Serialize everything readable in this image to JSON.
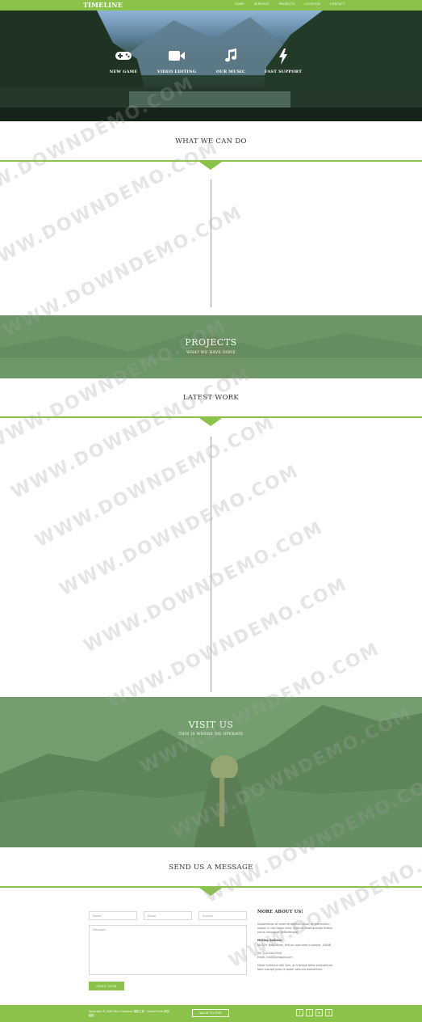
{
  "nav": {
    "brand": "TIMELINE",
    "items": [
      "HOME",
      "SERVICES",
      "PROJECTS",
      "LOCATION",
      "CONTACT"
    ]
  },
  "hero": {
    "features": [
      {
        "icon": "gamepad-icon",
        "label": "NEW GAME"
      },
      {
        "icon": "video-camera-icon",
        "label": "VIDEO EDITING"
      },
      {
        "icon": "music-note-icon",
        "label": "OUR MUSIC"
      },
      {
        "icon": "lightning-bolt-icon",
        "label": "FAST SUPPORT"
      }
    ]
  },
  "services": {
    "title": "WHAT WE CAN DO"
  },
  "projects_band": {
    "title": "PROJECTS",
    "subtitle": "WHAT WE HAVE DONE"
  },
  "latest_work": {
    "title": "LATEST WORK"
  },
  "visit_band": {
    "title": "VISIT US",
    "subtitle": "THIS IS WHERE WE OPERATE"
  },
  "contact": {
    "title": "SEND US A MESSAGE",
    "name_placeholder": "Name",
    "email_placeholder": "Email",
    "subject_placeholder": "Subject",
    "message_placeholder": "Message",
    "send_label": "SEND NOW",
    "about": {
      "heading": "MORE ABOUT US!",
      "intro": "Suspendisse sit amet fermentum dolor, et elementum augue. In non libero nulla. Nulla sit amet gravida finibus, purus consequat pellentesque.",
      "mailing_label": "Mailing Address:",
      "mailing_address": "No 129, New street, find on road area in people, 10056",
      "phone": "Tel: 010-020-0340",
      "email": "Email: info@company.com",
      "outro": "Morbi tincidunt nibh sem, ac tristique tellus euismod vel. Nam suscipit justo ut quam vehicula elementum."
    }
  },
  "footer": {
    "copyright": "Copyright © 2084 Your Company 模板之家 · Collect from 网页模板",
    "back_to_top": "BACK TO TOP",
    "socials": [
      {
        "icon": "facebook-icon",
        "glyph": "f"
      },
      {
        "icon": "twitter-icon",
        "glyph": "t"
      },
      {
        "icon": "linkedin-icon",
        "glyph": "in"
      },
      {
        "icon": "dribbble-icon",
        "glyph": "d"
      }
    ]
  },
  "watermark": "WWW.DOWNDEMO.COM",
  "colors": {
    "accent": "#8bc34a",
    "text": "#333333",
    "overlay": "#78aa6e"
  }
}
